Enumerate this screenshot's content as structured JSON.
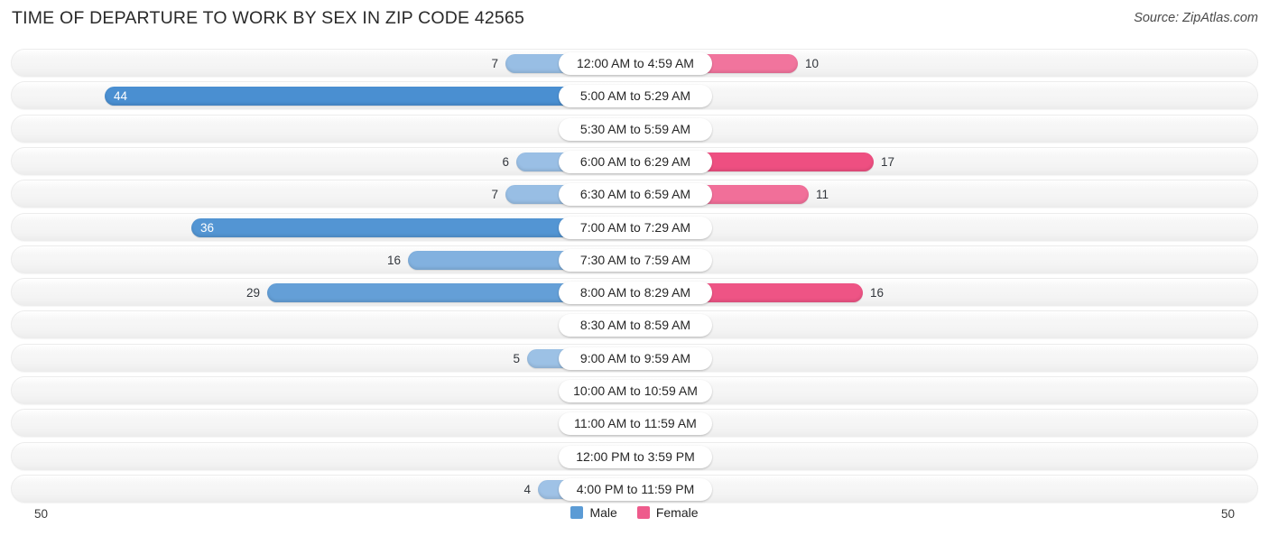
{
  "header": {
    "title": "TIME OF DEPARTURE TO WORK BY SEX IN ZIP CODE 42565",
    "source": "Source: ZipAtlas.com"
  },
  "legend": {
    "male_label": "Male",
    "female_label": "Female",
    "male_color": "#5b9bd5",
    "female_color": "#ee5b8c"
  },
  "axis": {
    "left_label": "50",
    "right_label": "50",
    "max": 50
  },
  "chart_data": {
    "type": "bar",
    "orientation": "horizontal-diverging",
    "title": "TIME OF DEPARTURE TO WORK BY SEX IN ZIP CODE 42565",
    "xlabel": "",
    "ylabel": "",
    "xlim": [
      50,
      50
    ],
    "grid": false,
    "legend_position": "bottom-center",
    "categories": [
      "12:00 AM to 4:59 AM",
      "5:00 AM to 5:29 AM",
      "5:30 AM to 5:59 AM",
      "6:00 AM to 6:29 AM",
      "6:30 AM to 6:59 AM",
      "7:00 AM to 7:29 AM",
      "7:30 AM to 7:59 AM",
      "8:00 AM to 8:29 AM",
      "8:30 AM to 8:59 AM",
      "9:00 AM to 9:59 AM",
      "10:00 AM to 10:59 AM",
      "11:00 AM to 11:59 AM",
      "12:00 PM to 3:59 PM",
      "4:00 PM to 11:59 PM"
    ],
    "series": [
      {
        "name": "Male",
        "values": [
          7,
          44,
          0,
          6,
          7,
          36,
          16,
          29,
          0,
          5,
          0,
          0,
          0,
          4
        ]
      },
      {
        "name": "Female",
        "values": [
          10,
          0,
          0,
          17,
          11,
          0,
          0,
          16,
          0,
          0,
          0,
          0,
          0,
          0
        ]
      }
    ]
  }
}
